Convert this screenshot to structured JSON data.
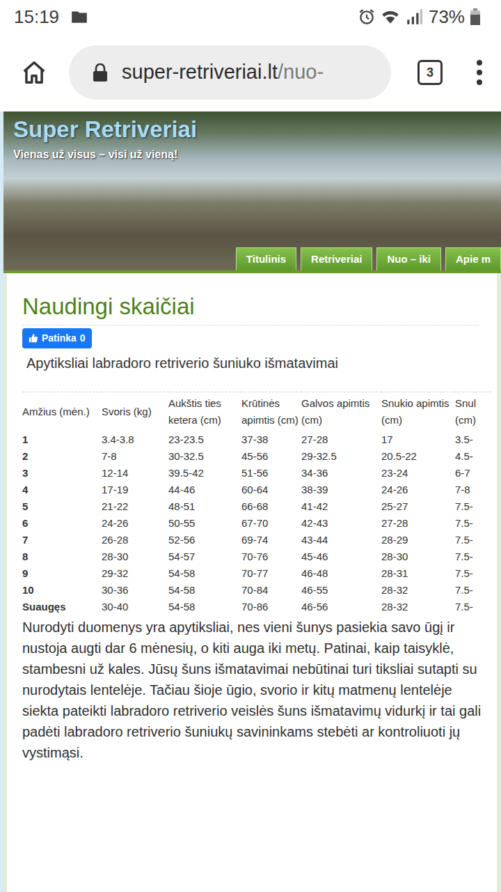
{
  "status_bar": {
    "time": "15:19",
    "battery": "73%"
  },
  "browser": {
    "url_host": "super-retriveriai.lt",
    "url_path": "/nuo-",
    "tab_count": "3"
  },
  "site": {
    "title": "Super Retriveriai",
    "tagline": "Vienas už visus – visi už vieną!",
    "nav": [
      {
        "label": "Titulinis",
        "selected": false
      },
      {
        "label": "Retriveriai",
        "selected": false
      },
      {
        "label": "Nuo – iki",
        "selected": false
      },
      {
        "label": "Apie m",
        "selected": false
      }
    ]
  },
  "page": {
    "heading": "Naudingi skaičiai",
    "like": {
      "label": "Patinka",
      "count": "0"
    },
    "subtitle": "Apytiksliai labradoro retriverio šuniuko išmatavimai",
    "table": {
      "columns": [
        "Amžius (mėn.)",
        "Svoris (kg)",
        "Aukštis ties ketera (cm)",
        "Krūtinės apimtis (cm)",
        "Galvos apimtis (cm)",
        "Snukio apimtis (cm)",
        "Snul (cm)"
      ],
      "rows": [
        [
          "1",
          "3.4-3.8",
          "23-23.5",
          "37-38",
          "27-28",
          "17",
          "3.5-"
        ],
        [
          "2",
          "7-8",
          "30-32.5",
          "45-56",
          "29-32.5",
          "20.5-22",
          "4.5-"
        ],
        [
          "3",
          "12-14",
          "39.5-42",
          "51-56",
          "34-36",
          "23-24",
          "6-7"
        ],
        [
          "4",
          "17-19",
          "44-46",
          "60-64",
          "38-39",
          "24-26",
          "7-8"
        ],
        [
          "5",
          "21-22",
          "48-51",
          "66-68",
          "41-42",
          "25-27",
          "7.5-"
        ],
        [
          "6",
          "24-26",
          "50-55",
          "67-70",
          "42-43",
          "27-28",
          "7.5-"
        ],
        [
          "7",
          "26-28",
          "52-56",
          "69-74",
          "43-44",
          "28-29",
          "7.5-"
        ],
        [
          "8",
          "28-30",
          "54-57",
          "70-76",
          "45-46",
          "28-30",
          "7.5-"
        ],
        [
          "9",
          "29-32",
          "54-58",
          "70-77",
          "46-48",
          "28-31",
          "7.5-"
        ],
        [
          "10",
          "30-36",
          "54-58",
          "70-84",
          "46-55",
          "28-32",
          "7.5-"
        ],
        [
          "Suaugęs",
          "30-40",
          "54-58",
          "70-86",
          "46-56",
          "28-32",
          "7.5-"
        ]
      ]
    },
    "note": "Nurodyti duomenys yra apytiksliai, nes vieni šunys pasiekia savo ūgį ir nustoja augti dar 6 mėnesių, o kiti auga iki metų. Patinai, kaip taisyklė, stambesni už kales. Jūsų šuns išmatavimai nebūtinai turi tiksliai sutapti su nurodytais lentelėje. Tačiau šioje ūgio, svorio ir kitų matmenų lentelėje siekta pateikti labradoro retriverio veislės šuns išmatavimų vidurkį ir tai gali padėti labradoro retriverio šuniukų savininkams stebėti ar kontroliuoti jų vystimąsi."
  }
}
